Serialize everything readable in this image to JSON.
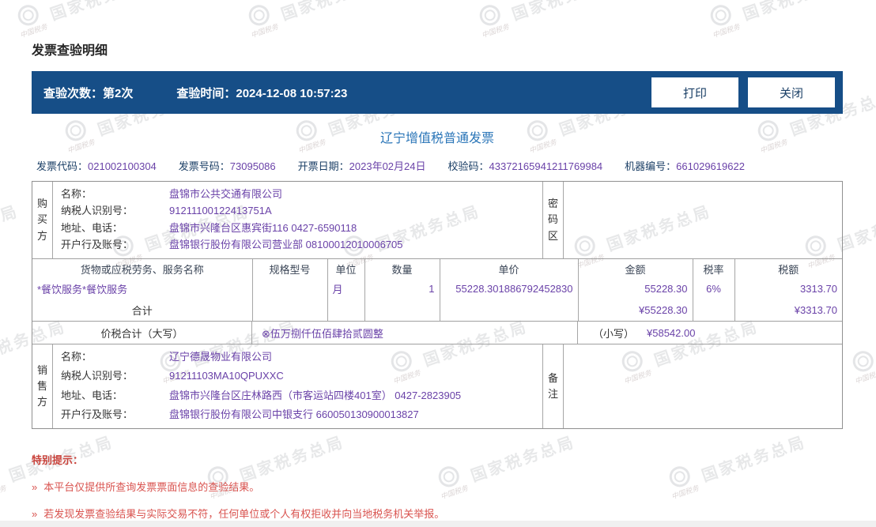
{
  "page": {
    "title": "发票查验明细",
    "watermark": {
      "text": "国家税务总局",
      "script": "中国税务"
    }
  },
  "colors": {
    "bar_blue": "#164e87",
    "title_blue": "#2b76b8",
    "value_purple": "#6a42a8",
    "label_navy": "#1b3f66",
    "warning_red": "#d9534f"
  },
  "topbar": {
    "check_count_label": "查验次数：",
    "check_count_value": "第2次",
    "check_time_label": "查验时间：",
    "check_time_value": "2024-12-08 10:57:23",
    "print_button": "打印",
    "close_button": "关闭"
  },
  "invoice": {
    "title": "辽宁增值税普通发票",
    "meta": [
      {
        "label": "发票代码：",
        "value": "021002100304"
      },
      {
        "label": "发票号码：",
        "value": "73095086"
      },
      {
        "label": "开票日期：",
        "value": "2023年02月24日"
      },
      {
        "label": "校验码：",
        "value": "43372165941211769984"
      },
      {
        "label": "机器编号：",
        "value": "661029619622"
      }
    ],
    "buyer": {
      "side_label": "购买方",
      "rows": [
        {
          "label": "名称：",
          "value": "盘锦市公共交通有限公司"
        },
        {
          "label": "纳税人识别号：",
          "value": "91211100122413751A"
        },
        {
          "label": "地址、电话：",
          "value": "盘锦市兴隆台区惠宾街116 0427-6590118"
        },
        {
          "label": "开户行及账号：",
          "value": "盘锦银行股份有限公司营业部 08100012010006705"
        }
      ],
      "password_area_label": "密码区",
      "password_area_value": ""
    },
    "items": {
      "headers": [
        "货物或应税劳务、服务名称",
        "规格型号",
        "单位",
        "数量",
        "单价",
        "金额",
        "税率",
        "税额"
      ],
      "rows": [
        {
          "name": "*餐饮服务*餐饮服务",
          "spec": "",
          "unit": "月",
          "qty": "1",
          "price": "55228.301886792452830",
          "amount": "55228.30",
          "tax_rate": "6%",
          "tax": "3313.70"
        }
      ],
      "total": {
        "label": "合计",
        "amount": "¥55228.30",
        "tax": "¥3313.70"
      }
    },
    "total_row": {
      "label": "价税合计（大写）",
      "uppercase": "⊗伍万捌仟伍佰肆拾贰圆整",
      "lowercase_label": "（小写）",
      "lowercase_value": "¥58542.00"
    },
    "seller": {
      "side_label": "销售方",
      "rows": [
        {
          "label": "名称：",
          "value": "辽宁德晟物业有限公司"
        },
        {
          "label": "纳税人识别号：",
          "value": "91211103MA10QPUXXC"
        },
        {
          "label": "地址、电话：",
          "value": "盘锦市兴隆台区庄林路西（市客运站四楼401室） 0427-2823905"
        },
        {
          "label": "开户行及账号：",
          "value": "盘锦银行股份有限公司中银支行 660050130900013827"
        }
      ],
      "remark_label": "备注",
      "remark_value": ""
    }
  },
  "notice": {
    "title": "特别提示：",
    "bullet": "»",
    "items": [
      "本平台仅提供所查询发票票面信息的查验结果。",
      "若发现发票查验结果与实际交易不符，任何单位或个人有权拒收并向当地税务机关举报。"
    ]
  }
}
